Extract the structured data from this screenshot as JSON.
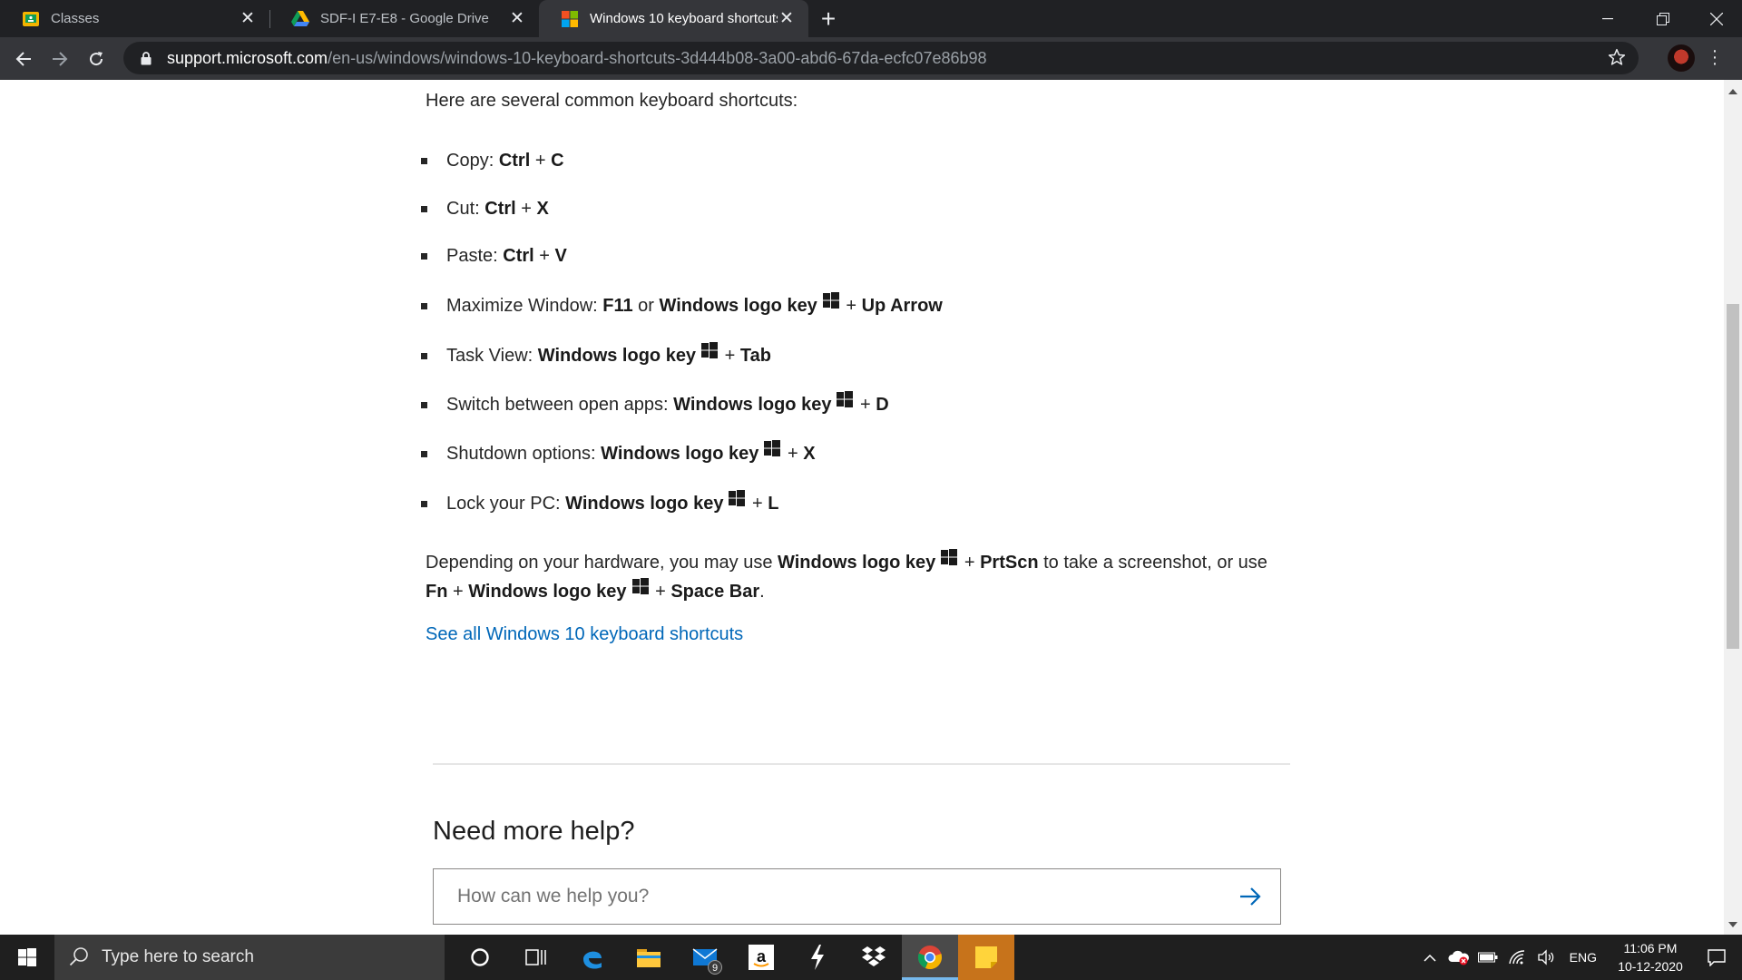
{
  "browser": {
    "tabs": [
      {
        "title": "Classes",
        "active": false,
        "favicon": "google-classroom-icon"
      },
      {
        "title": "SDF-I E7-E8 - Google Drive",
        "active": false,
        "favicon": "google-drive-icon"
      },
      {
        "title": "Windows 10 keyboard shortcuts",
        "active": true,
        "favicon": "microsoft-logo-icon"
      }
    ],
    "url_host": "support.microsoft.com",
    "url_path": "/en-us/windows/windows-10-keyboard-shortcuts-3d444b08-3a00-abd6-67da-ecfc07e86b98"
  },
  "content": {
    "intro": "Here are several common keyboard shortcuts:",
    "shortcuts": [
      {
        "label": "Copy: ",
        "k1": "Ctrl",
        "plus1": " + ",
        "k2": "C"
      },
      {
        "label": "Cut: ",
        "k1": "Ctrl",
        "plus1": " + ",
        "k2": "X"
      },
      {
        "label": "Paste: ",
        "k1": "Ctrl",
        "plus1": " + ",
        "k2": "V"
      },
      {
        "label": "Maximize Window: ",
        "k1": "F11",
        "or": " or ",
        "k2": "Windows logo key",
        "plus1": " + ",
        "k3": "Up Arrow"
      },
      {
        "label": "Task View: ",
        "k1": "Windows logo key",
        "plus1": " + ",
        "k2": "Tab"
      },
      {
        "label": "Switch between open apps: ",
        "k1": "Windows logo key",
        "plus1": " + ",
        "k2": "D"
      },
      {
        "label": "Shutdown options: ",
        "k1": "Windows logo key",
        "plus1": " + ",
        "k2": "X"
      },
      {
        "label": "Lock your PC: ",
        "k1": "Windows logo key",
        "plus1": " + ",
        "k2": "L"
      }
    ],
    "hardware_para": {
      "t1": "Depending on your hardware, you may use ",
      "k1": "Windows logo key",
      "p1": " + ",
      "k2": "PrtScn",
      "t2": " to take a screenshot, or use ",
      "k3": "Fn",
      "p2": " + ",
      "k4": "Windows logo key",
      "p3": " + ",
      "k5": "Space Bar",
      "t3": "."
    },
    "see_all_link": "See all Windows 10 keyboard shortcuts"
  },
  "help": {
    "title": "Need more help?",
    "placeholder": "How can we help you?"
  },
  "taskbar": {
    "search_placeholder": "Type here to search",
    "mail_badge": "9",
    "language": "ENG",
    "time": "11:06 PM",
    "date": "10-12-2020"
  },
  "colors": {
    "link": "#0067b8",
    "chrome_dark": "#202124",
    "chrome_toolbar": "#35363a",
    "taskbar": "#1f1f1f"
  }
}
